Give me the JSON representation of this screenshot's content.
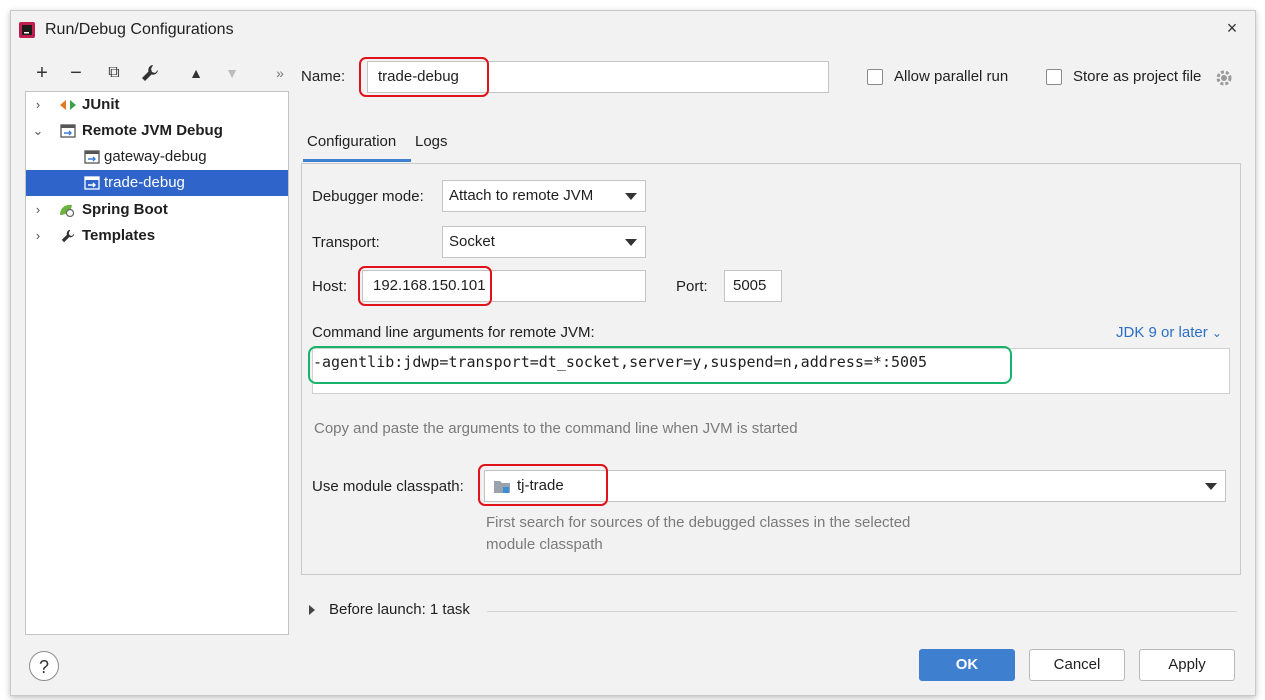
{
  "window": {
    "title": "Run/Debug Configurations",
    "close": "×"
  },
  "toolbar": {
    "add": "+",
    "remove": "−",
    "copy": "⧉",
    "edit": "🔧",
    "up": "▲",
    "down": "▼",
    "more": "»"
  },
  "tree": {
    "items": [
      {
        "label": "JUnit"
      },
      {
        "label": "Remote JVM Debug"
      },
      {
        "label": "gateway-debug"
      },
      {
        "label": "trade-debug"
      },
      {
        "label": "Spring Boot"
      },
      {
        "label": "Templates"
      }
    ]
  },
  "name_field": {
    "label": "Name:",
    "value": "trade-debug"
  },
  "options": {
    "allow_parallel": "Allow parallel run",
    "store_project": "Store as project file"
  },
  "tabs": [
    {
      "label": "Configuration"
    },
    {
      "label": "Logs"
    }
  ],
  "config": {
    "debugger_mode": {
      "label": "Debugger mode:",
      "value": "Attach to remote JVM"
    },
    "transport": {
      "label": "Transport:",
      "value": "Socket"
    },
    "host": {
      "label": "Host:",
      "value": "192.168.150.101"
    },
    "port": {
      "label": "Port:",
      "value": "5005"
    },
    "cmd": {
      "label": "Command line arguments for remote JVM:",
      "jdk_link": "JDK 9 or later",
      "value": "-agentlib:jdwp=transport=dt_socket,server=y,suspend=n,address=*:5005",
      "hint": "Copy and paste the arguments to the command line when JVM is started"
    },
    "module": {
      "label": "Use module classpath:",
      "value": "tj-trade",
      "hint_line1": "First search for sources of the debugged classes in the selected",
      "hint_line2": "module classpath"
    }
  },
  "before_launch": {
    "label": "Before launch: 1 task"
  },
  "buttons": {
    "help": "?",
    "ok": "OK",
    "cancel": "Cancel",
    "apply": "Apply"
  },
  "colors": {
    "selection": "#2f65ca",
    "highlight_red": "#e0121c",
    "highlight_green": "#17b36a",
    "primary": "#3f7fd0"
  }
}
